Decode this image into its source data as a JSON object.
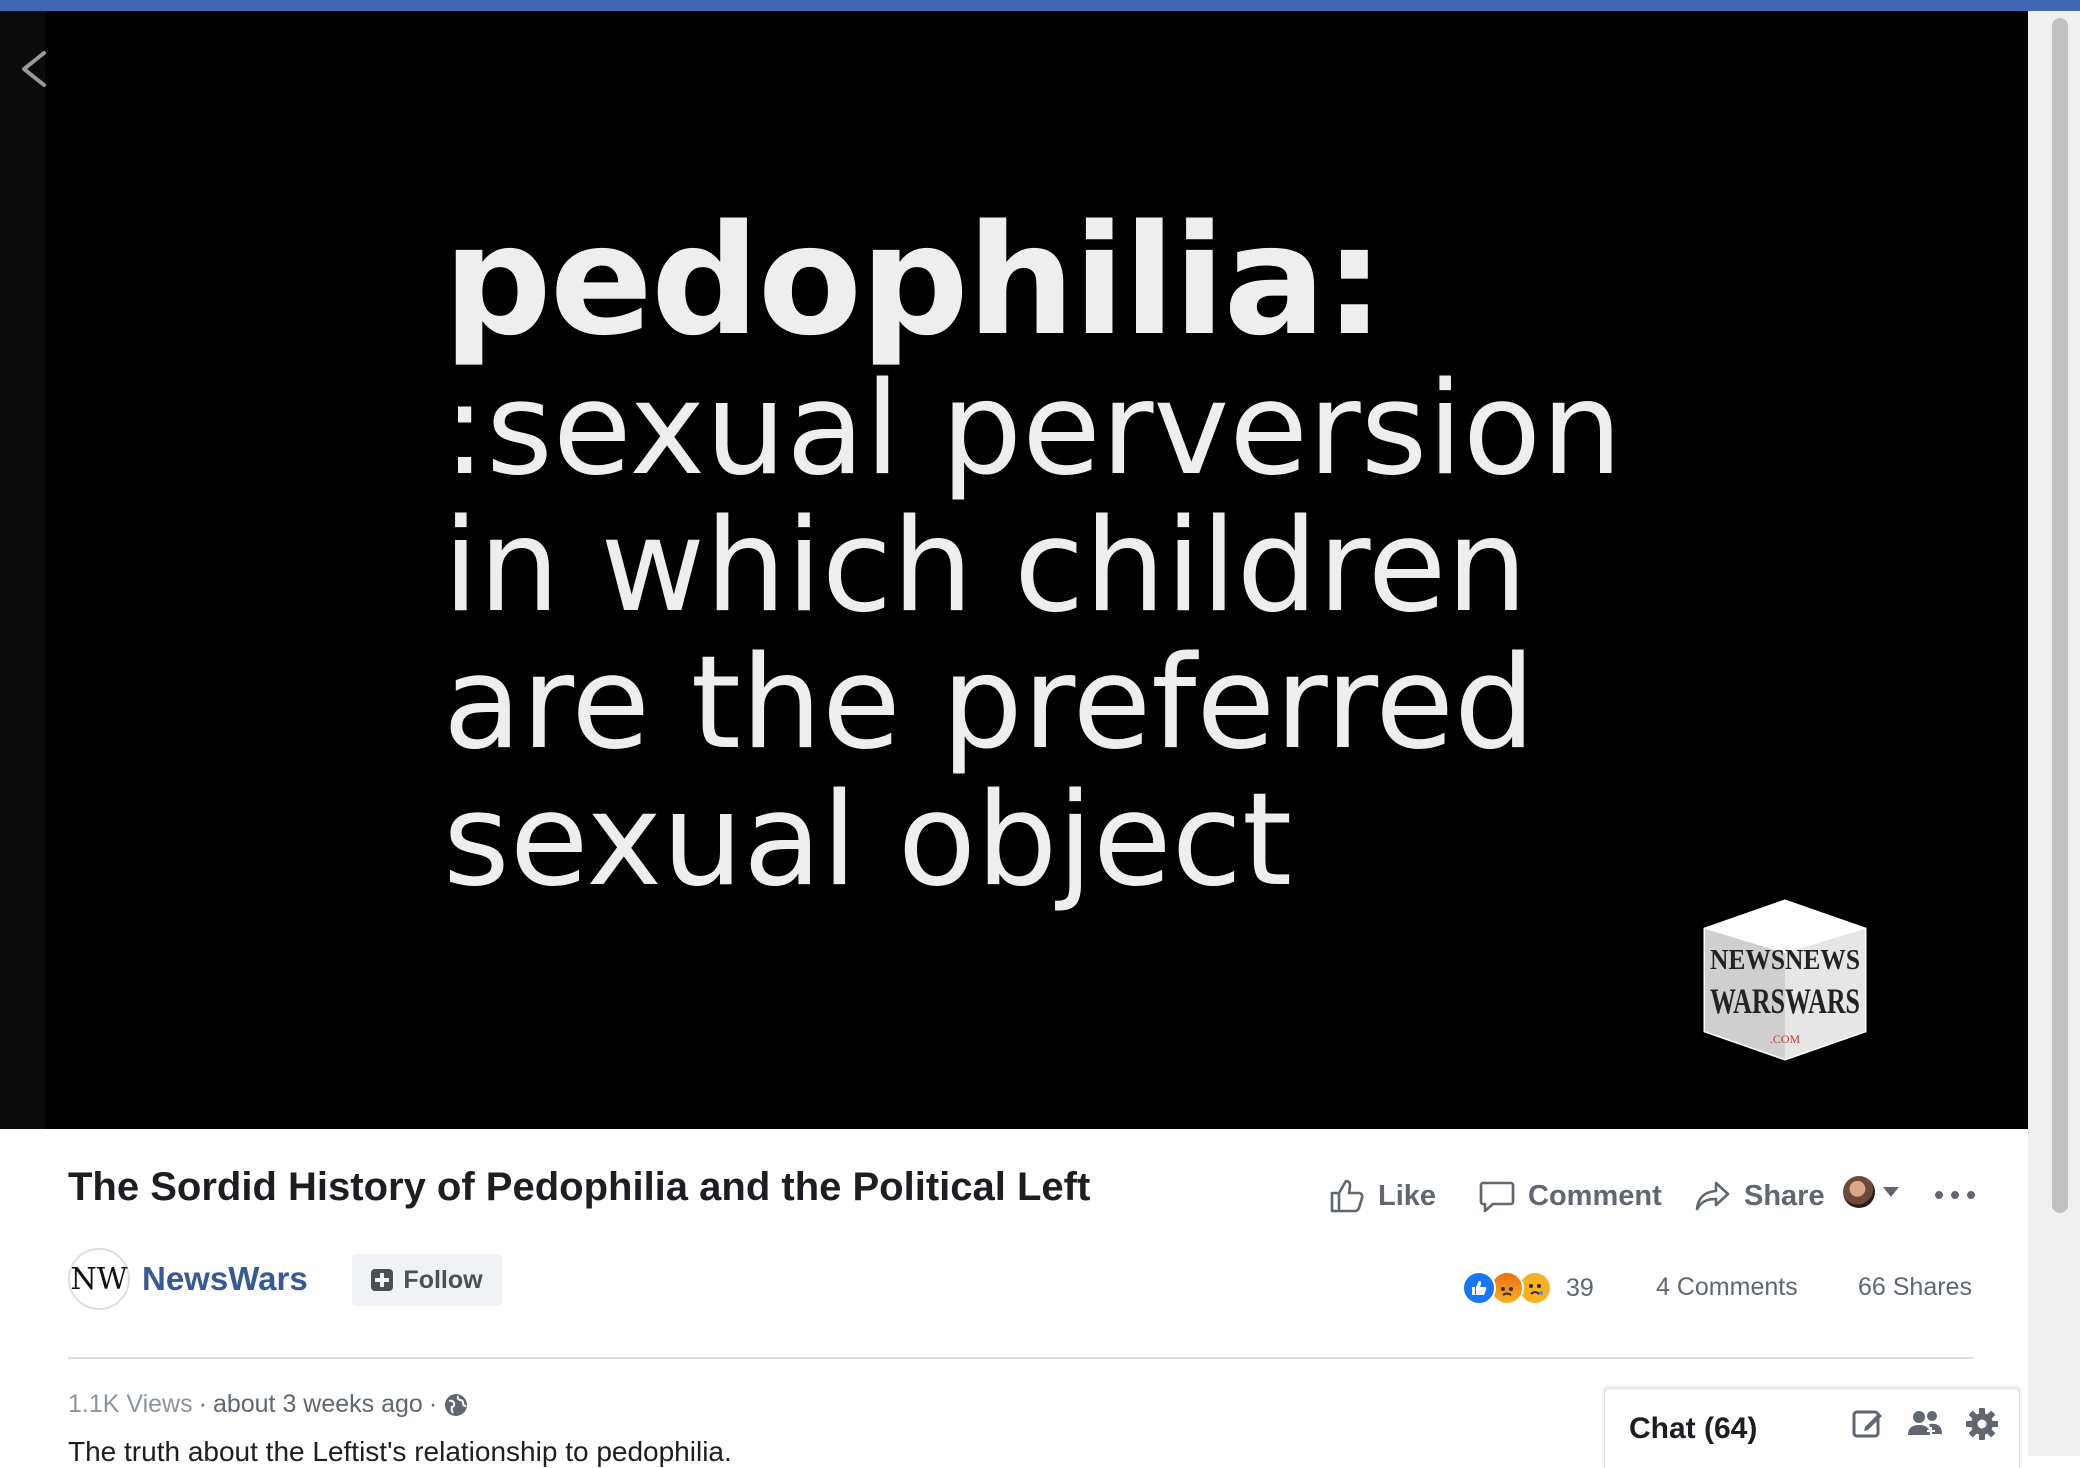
{
  "video": {
    "caption_headline": "pedophilia:",
    "caption_lines": [
      ":sexual perversion",
      "in which children",
      "are the preferred",
      "sexual object"
    ],
    "watermark_lines": [
      "NEWSNEWS",
      "WARSWARS",
      ".COM"
    ]
  },
  "post": {
    "title": "The Sordid History of Pedophilia and the Political Left",
    "actions": {
      "like": "Like",
      "comment": "Comment",
      "share": "Share"
    },
    "page": {
      "avatar_initials": "NW",
      "name": "NewsWars",
      "follow_label": "Follow"
    },
    "stats": {
      "reaction_count": "39",
      "comments": "4 Comments",
      "shares": "66 Shares"
    },
    "meta": {
      "views": "1.1K Views",
      "separator": "·",
      "time": "about 3 weeks ago",
      "separator2": "·"
    },
    "description": "The truth about the Leftist's relationship to pedophilia."
  },
  "chat": {
    "label": "Chat (64)"
  },
  "colors": {
    "top_bar": "#4267b2",
    "link": "#385898",
    "secondary_text": "#606770"
  }
}
